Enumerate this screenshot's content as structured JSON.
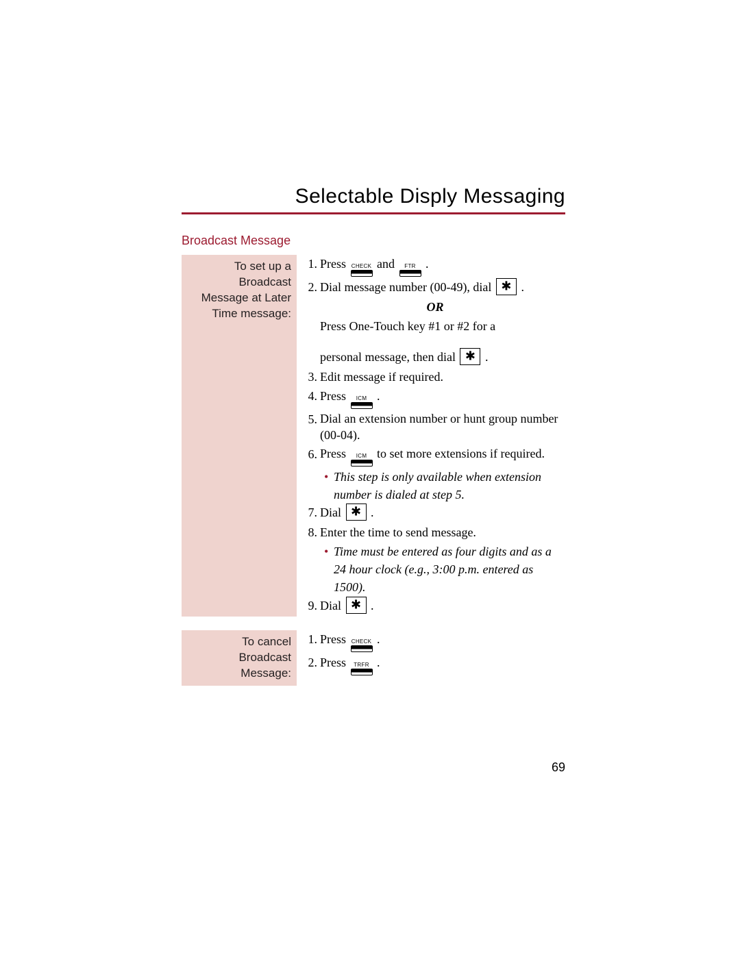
{
  "title": "Selectable Disply Messaging",
  "section_heading": "Broadcast Message",
  "page_number": "69",
  "buttons": {
    "check": "CHECK",
    "ftr": "FTR",
    "icm": "ICM",
    "trfr": "TRFR"
  },
  "setup": {
    "side_label": "To set up a Broadcast Message at Later Time message:",
    "steps": {
      "s1_a": "Press",
      "s1_b": "and",
      "s1_c": ".",
      "s2_a": "Dial message number (00-49), dial",
      "s2_b": ".",
      "or": "OR",
      "s2_alt1": "Press One-Touch key #1 or #2 for a",
      "s2_alt2": "personal message, then dial",
      "s2_alt2_b": ".",
      "s3": "Edit message if required.",
      "s4_a": "Press",
      "s4_b": ".",
      "s5": "Dial an extension number or hunt group number (00-04).",
      "s6_a": "Press",
      "s6_b": "to set more extensions if required.",
      "s6_note": "This step is only available when extension number is dialed at step 5.",
      "s7_a": "Dial",
      "s7_b": ".",
      "s8": "Enter the time to send message.",
      "s8_note": "Time must be entered as four digits and as a 24 hour clock (e.g., 3:00 p.m. entered as 1500).",
      "s9_a": "Dial",
      "s9_b": "."
    }
  },
  "cancel": {
    "side_label": "To cancel Broadcast Message:",
    "steps": {
      "s1_a": "Press",
      "s1_b": ".",
      "s2_a": "Press",
      "s2_b": "."
    }
  }
}
